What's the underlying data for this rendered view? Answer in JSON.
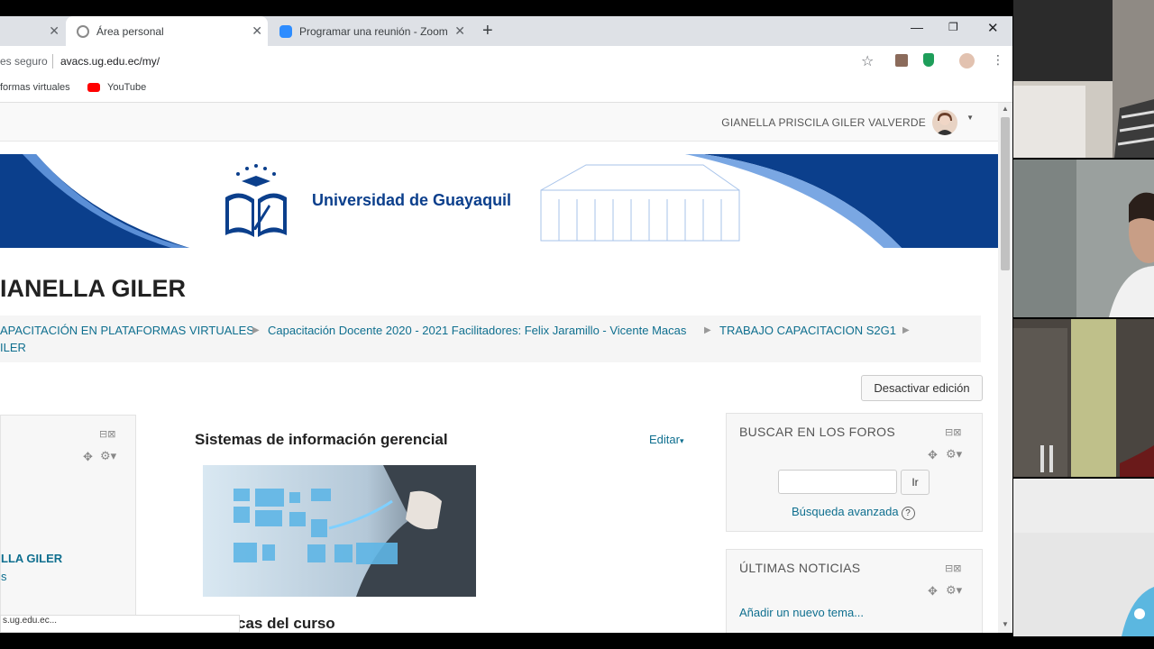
{
  "browser": {
    "tabs": [
      {
        "label": "",
        "active": false
      },
      {
        "label": "Área personal",
        "active": true
      },
      {
        "label": "Programar una reunión - Zoom",
        "active": false
      }
    ],
    "new_tab": "+",
    "address": {
      "security": "es seguro",
      "url": "avacs.ug.edu.ec/my/"
    },
    "bookmarks": [
      {
        "label": "formas virtuales"
      },
      {
        "label": "YouTube"
      }
    ],
    "status_url": "s.ug.edu.ec..."
  },
  "site": {
    "user_name": "GIANELLA PRISCILA GILER VALVERDE",
    "university_name": "Universidad de Guayaquil",
    "page_title": "IANELLA GILER",
    "breadcrumb": [
      "APACITACIÓN EN PLATAFORMAS VIRTUALES",
      "Capacitación Docente 2020 - 2021 Facilitadores: Felix Jaramillo - Vicente Macas",
      "TRABAJO CAPACITACION S2G1",
      "ILER"
    ],
    "edit_off_button": "Desactivar edición",
    "left_block": {
      "name": "LLA GILER",
      "extra": "s"
    },
    "course": {
      "title": "Sistemas de información gerencial",
      "edit_label": "Editar",
      "subtitle": "cas del curso"
    },
    "search_forums": {
      "title": "BUSCAR EN LOS FOROS",
      "button": "Ir",
      "advanced": "Búsqueda avanzada",
      "help": "?"
    },
    "news": {
      "title": "ÚLTIMAS NOTICIAS",
      "add_topic": "Añadir un nuevo tema..."
    }
  },
  "colors": {
    "link": "#0f6f8f",
    "banner_blue": "#0b3f8c",
    "tab_bar": "#dee1e6"
  }
}
